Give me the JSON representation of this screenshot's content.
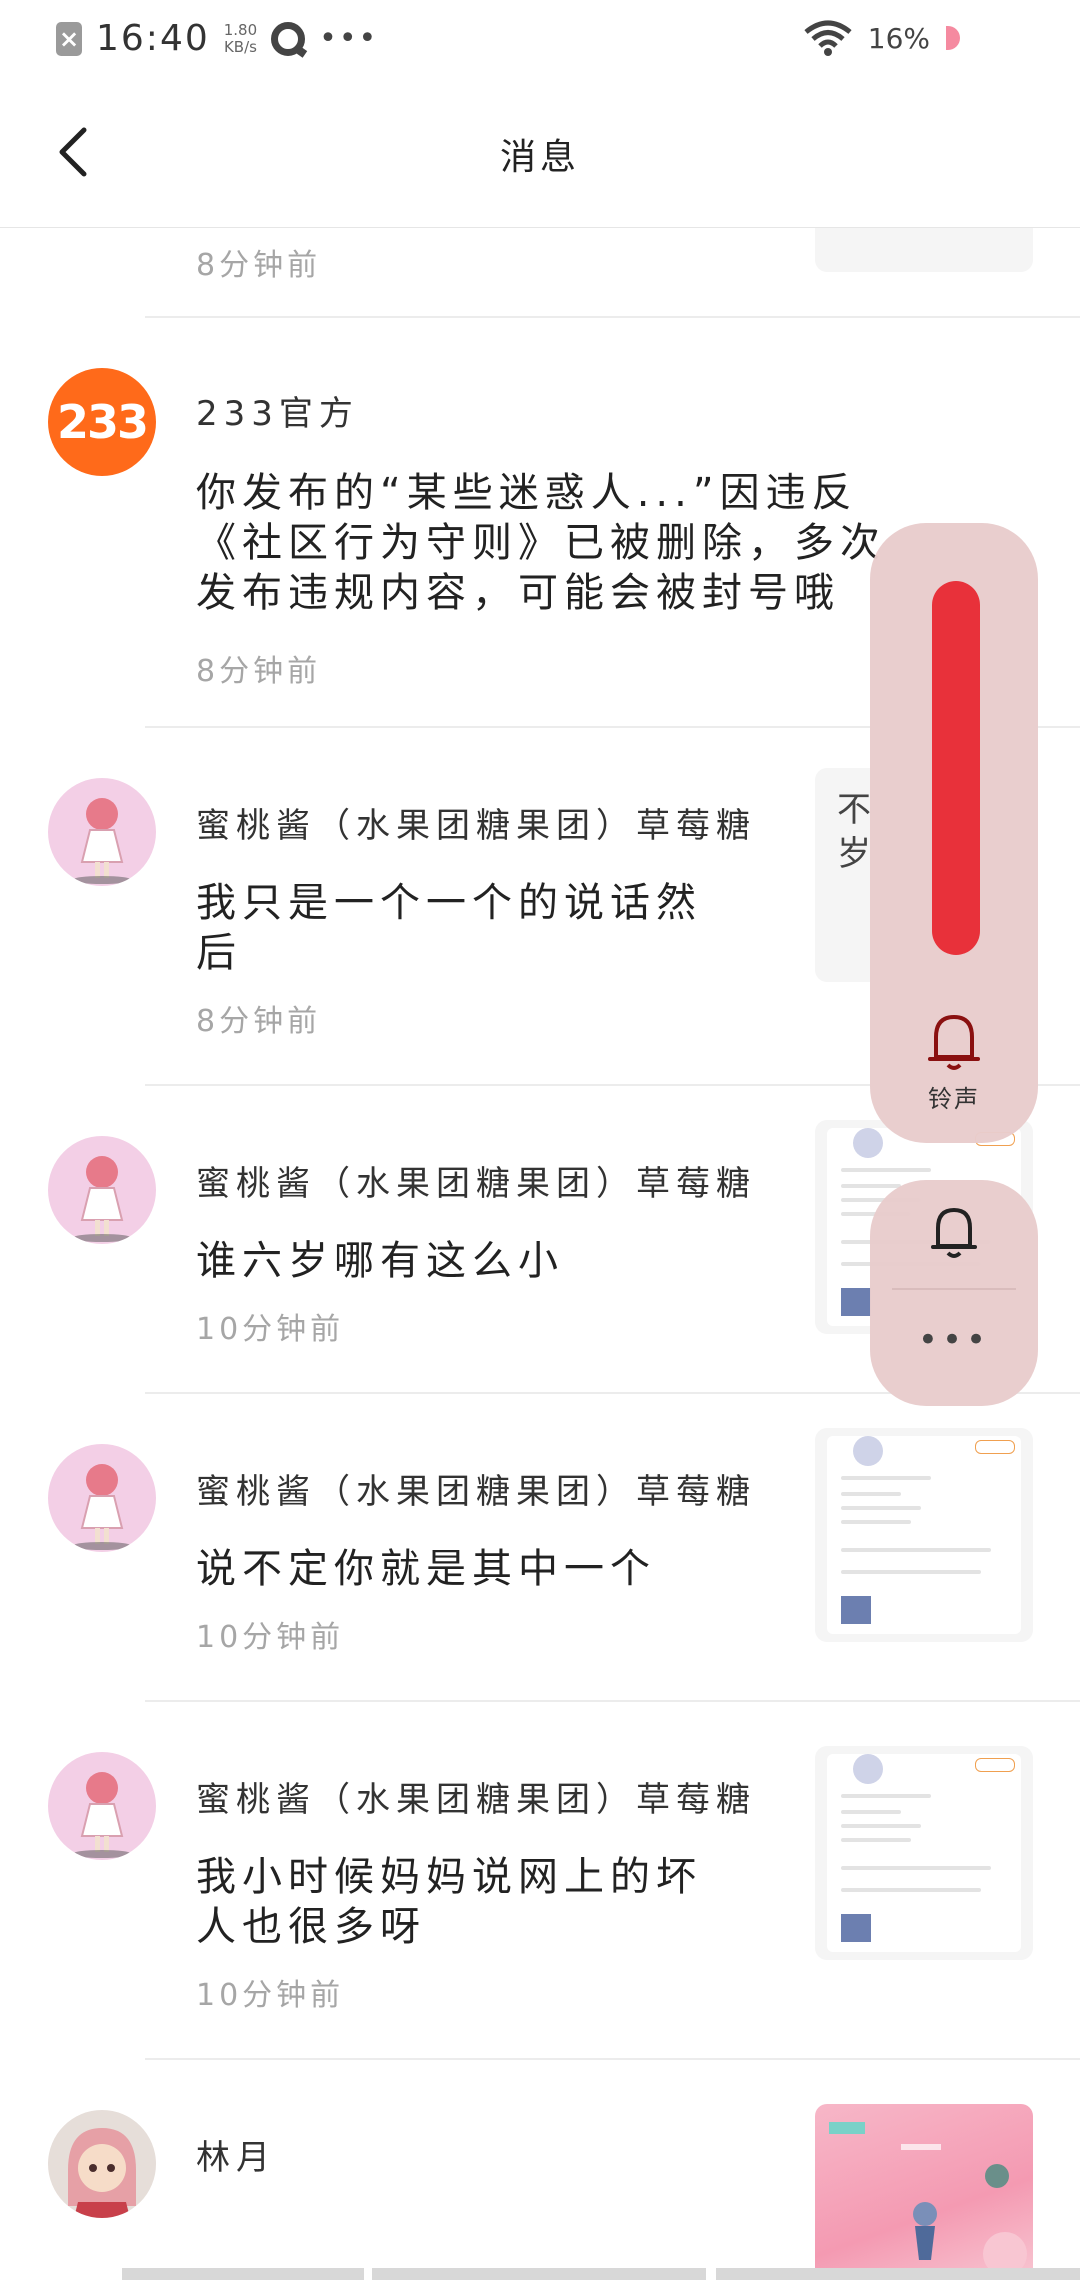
{
  "status_bar": {
    "time": "16:40",
    "speed_value": "1.80",
    "speed_unit": "KB/s",
    "more": "•••",
    "battery": "16%"
  },
  "header": {
    "title": "消息"
  },
  "messages": [
    {
      "time": "8分钟前"
    },
    {
      "avatar_text": "233",
      "name": "233官方",
      "content": "你发布的“某些迷惑人...”因违反《社区行为守则》已被删除，多次发布违规内容，可能会被封号哦",
      "time": "8分钟前"
    },
    {
      "name": "蜜桃酱（水果团糖果团）草莓糖",
      "content": "我只是一个一个的说话然后",
      "time": "8分钟前",
      "thumb_text": "不\n岁"
    },
    {
      "name": "蜜桃酱（水果团糖果团）草莓糖",
      "content": "谁六岁哪有这么小",
      "time": "10分钟前"
    },
    {
      "name": "蜜桃酱（水果团糖果团）草莓糖",
      "content": "说不定你就是其中一个",
      "time": "10分钟前"
    },
    {
      "name": "蜜桃酱（水果团糖果团）草莓糖",
      "content": "我小时候妈妈说网上的坏人也很多呀",
      "time": "10分钟前"
    },
    {
      "name": "林月"
    }
  ],
  "volume_overlay": {
    "level": 1.0,
    "mode_label": "铃声",
    "more": "•••"
  },
  "colors": {
    "accent_red": "#e8313a",
    "brand_233": "#ff6a1a",
    "overlay_bg": "#e8cccc"
  }
}
